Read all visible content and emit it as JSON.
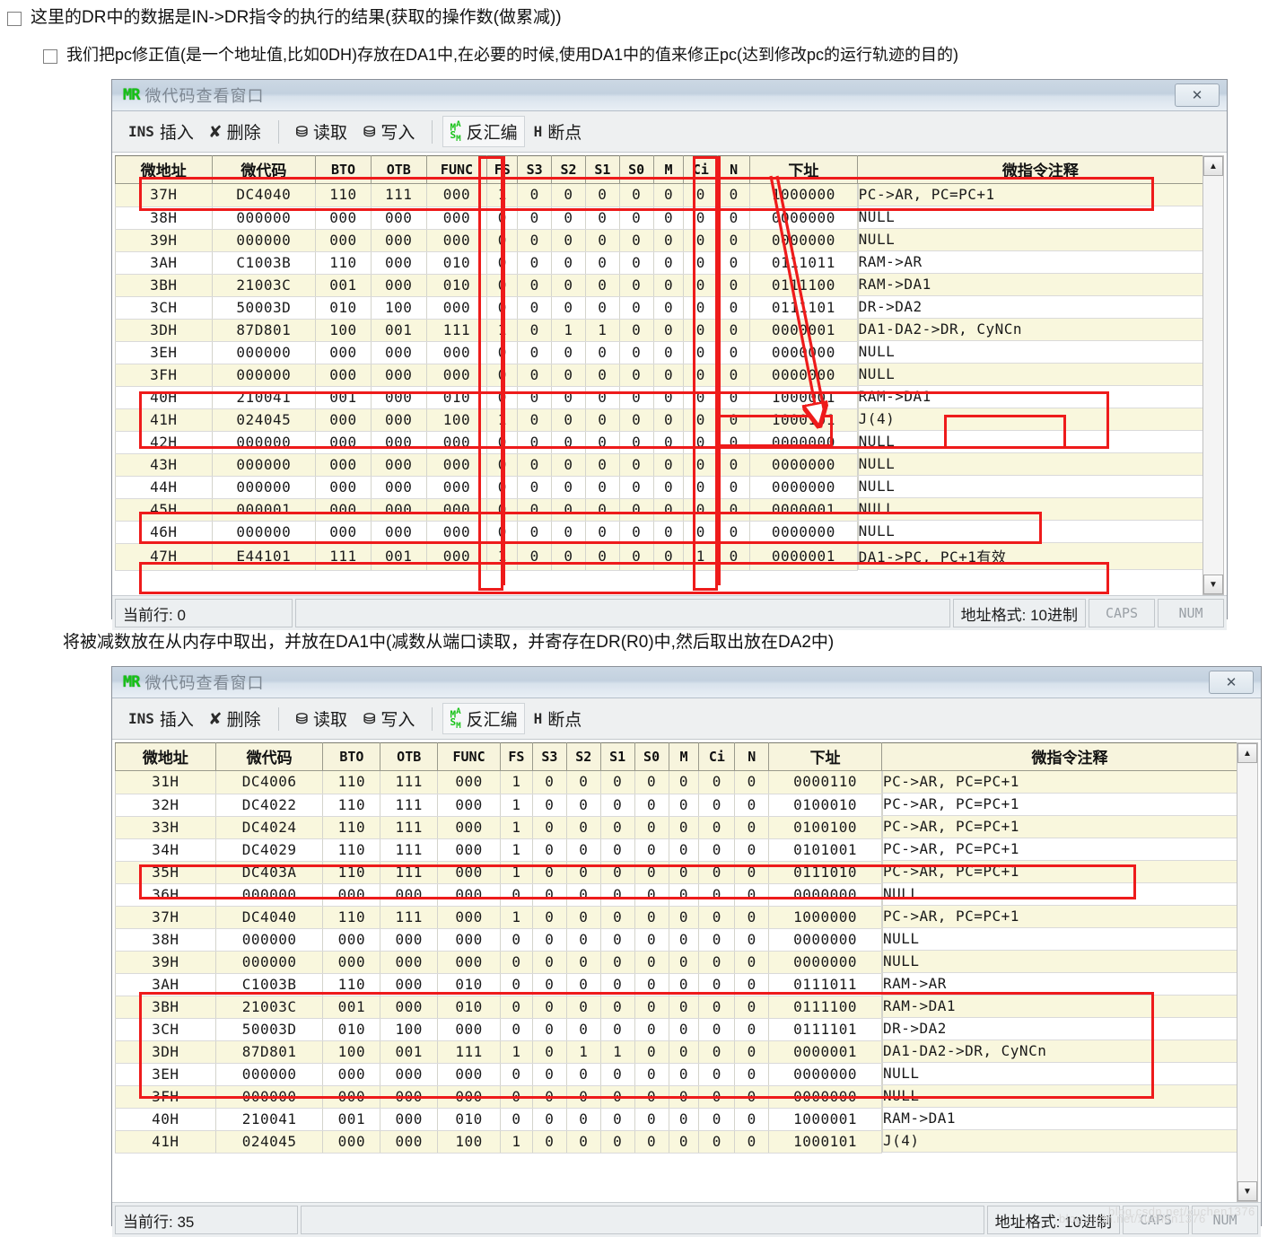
{
  "notes": {
    "line1": "这里的DR中的数据是IN->DR指令的执行的结果(获取的操作数(做累减))",
    "line2": "我们把pc修正值(是一个地址值,比如0DH)存放在DA1中,在必要的时候,使用DA1中的值来修正pc(达到修改pc的运行轨迹的目的)",
    "middle": "将被减数放在从内存中取出，并放在DA1中(减数从端口读取，并寄存在DR(R0)中,然后取出放在DA2中)"
  },
  "window": {
    "title": "微代码查看窗口",
    "logo": "MR",
    "close_label": "✕",
    "toolbar": [
      {
        "icon": "INS",
        "icon_name": "insert-icon",
        "label": "插入"
      },
      {
        "icon": "✘",
        "icon_name": "delete-x-icon",
        "label": "删除"
      },
      {
        "icon": "⛁",
        "icon_name": "read-icon",
        "label": "读取"
      },
      {
        "icon": "⛁",
        "icon_name": "write-icon",
        "label": "写入"
      },
      {
        "icon": "MASM",
        "icon_name": "masm-icon",
        "label": "反汇编"
      },
      {
        "icon": "H",
        "icon_name": "breakpoint-icon",
        "label": "断点"
      }
    ],
    "columns": [
      "微地址",
      "微代码",
      "BTO",
      "OTB",
      "FUNC",
      "FS",
      "S3",
      "S2",
      "S1",
      "S0",
      "M",
      "Ci",
      "N",
      "下址",
      "微指令注释"
    ],
    "scroll_up": "▲",
    "scroll_down": "▼"
  },
  "window1": {
    "status": {
      "current_row": "当前行: 0",
      "addr_format": "地址格式: 10进制",
      "caps": "CAPS",
      "num": "NUM"
    },
    "rows": [
      {
        "addr": "37H",
        "code": "DC4040",
        "bto": "110",
        "otb": "111",
        "func": "000",
        "fs": "1",
        "s3": "0",
        "s2": "0",
        "s1": "0",
        "s0": "0",
        "m": "0",
        "ci": "0",
        "n": "0",
        "next": "1000000",
        "comment": "PC->AR, PC=PC+1"
      },
      {
        "addr": "38H",
        "code": "000000",
        "bto": "000",
        "otb": "000",
        "func": "000",
        "fs": "0",
        "s3": "0",
        "s2": "0",
        "s1": "0",
        "s0": "0",
        "m": "0",
        "ci": "0",
        "n": "0",
        "next": "0000000",
        "comment": "NULL"
      },
      {
        "addr": "39H",
        "code": "000000",
        "bto": "000",
        "otb": "000",
        "func": "000",
        "fs": "0",
        "s3": "0",
        "s2": "0",
        "s1": "0",
        "s0": "0",
        "m": "0",
        "ci": "0",
        "n": "0",
        "next": "0000000",
        "comment": "NULL"
      },
      {
        "addr": "3AH",
        "code": "C1003B",
        "bto": "110",
        "otb": "000",
        "func": "010",
        "fs": "0",
        "s3": "0",
        "s2": "0",
        "s1": "0",
        "s0": "0",
        "m": "0",
        "ci": "0",
        "n": "0",
        "next": "0111011",
        "comment": "RAM->AR"
      },
      {
        "addr": "3BH",
        "code": "21003C",
        "bto": "001",
        "otb": "000",
        "func": "010",
        "fs": "0",
        "s3": "0",
        "s2": "0",
        "s1": "0",
        "s0": "0",
        "m": "0",
        "ci": "0",
        "n": "0",
        "next": "0111100",
        "comment": "RAM->DA1"
      },
      {
        "addr": "3CH",
        "code": "50003D",
        "bto": "010",
        "otb": "100",
        "func": "000",
        "fs": "0",
        "s3": "0",
        "s2": "0",
        "s1": "0",
        "s0": "0",
        "m": "0",
        "ci": "0",
        "n": "0",
        "next": "0111101",
        "comment": "DR->DA2"
      },
      {
        "addr": "3DH",
        "code": "87D801",
        "bto": "100",
        "otb": "001",
        "func": "111",
        "fs": "1",
        "s3": "0",
        "s2": "1",
        "s1": "1",
        "s0": "0",
        "m": "0",
        "ci": "0",
        "n": "0",
        "next": "0000001",
        "comment": "DA1-DA2->DR, CyNCn"
      },
      {
        "addr": "3EH",
        "code": "000000",
        "bto": "000",
        "otb": "000",
        "func": "000",
        "fs": "0",
        "s3": "0",
        "s2": "0",
        "s1": "0",
        "s0": "0",
        "m": "0",
        "ci": "0",
        "n": "0",
        "next": "0000000",
        "comment": "NULL"
      },
      {
        "addr": "3FH",
        "code": "000000",
        "bto": "000",
        "otb": "000",
        "func": "000",
        "fs": "0",
        "s3": "0",
        "s2": "0",
        "s1": "0",
        "s0": "0",
        "m": "0",
        "ci": "0",
        "n": "0",
        "next": "0000000",
        "comment": "NULL"
      },
      {
        "addr": "40H",
        "code": "210041",
        "bto": "001",
        "otb": "000",
        "func": "010",
        "fs": "0",
        "s3": "0",
        "s2": "0",
        "s1": "0",
        "s0": "0",
        "m": "0",
        "ci": "0",
        "n": "0",
        "next": "1000001",
        "comment": "RAM->DA1"
      },
      {
        "addr": "41H",
        "code": "024045",
        "bto": "000",
        "otb": "000",
        "func": "100",
        "fs": "1",
        "s3": "0",
        "s2": "0",
        "s1": "0",
        "s0": "0",
        "m": "0",
        "ci": "0",
        "n": "0",
        "next": "1000101",
        "comment": "J(4)"
      },
      {
        "addr": "42H",
        "code": "000000",
        "bto": "000",
        "otb": "000",
        "func": "000",
        "fs": "0",
        "s3": "0",
        "s2": "0",
        "s1": "0",
        "s0": "0",
        "m": "0",
        "ci": "0",
        "n": "0",
        "next": "0000000",
        "comment": "NULL"
      },
      {
        "addr": "43H",
        "code": "000000",
        "bto": "000",
        "otb": "000",
        "func": "000",
        "fs": "0",
        "s3": "0",
        "s2": "0",
        "s1": "0",
        "s0": "0",
        "m": "0",
        "ci": "0",
        "n": "0",
        "next": "0000000",
        "comment": "NULL"
      },
      {
        "addr": "44H",
        "code": "000000",
        "bto": "000",
        "otb": "000",
        "func": "000",
        "fs": "0",
        "s3": "0",
        "s2": "0",
        "s1": "0",
        "s0": "0",
        "m": "0",
        "ci": "0",
        "n": "0",
        "next": "0000000",
        "comment": "NULL"
      },
      {
        "addr": "45H",
        "code": "000001",
        "bto": "000",
        "otb": "000",
        "func": "000",
        "fs": "0",
        "s3": "0",
        "s2": "0",
        "s1": "0",
        "s0": "0",
        "m": "0",
        "ci": "0",
        "n": "0",
        "next": "0000001",
        "comment": "NULL"
      },
      {
        "addr": "46H",
        "code": "000000",
        "bto": "000",
        "otb": "000",
        "func": "000",
        "fs": "0",
        "s3": "0",
        "s2": "0",
        "s1": "0",
        "s0": "0",
        "m": "0",
        "ci": "0",
        "n": "0",
        "next": "0000000",
        "comment": "NULL"
      },
      {
        "addr": "47H",
        "code": "E44101",
        "bto": "111",
        "otb": "001",
        "func": "000",
        "fs": "1",
        "s3": "0",
        "s2": "0",
        "s1": "0",
        "s0": "0",
        "m": "0",
        "ci": "1",
        "n": "0",
        "next": "0000001",
        "comment": "DA1->PC, PC+1有效"
      }
    ]
  },
  "window2": {
    "status": {
      "current_row": "当前行: 35",
      "addr_format": "地址格式: 10进制",
      "caps": "CAPS",
      "num": "NUM"
    },
    "rows": [
      {
        "addr": "31H",
        "code": "DC4006",
        "bto": "110",
        "otb": "111",
        "func": "000",
        "fs": "1",
        "s3": "0",
        "s2": "0",
        "s1": "0",
        "s0": "0",
        "m": "0",
        "ci": "0",
        "n": "0",
        "next": "0000110",
        "comment": "PC->AR, PC=PC+1"
      },
      {
        "addr": "32H",
        "code": "DC4022",
        "bto": "110",
        "otb": "111",
        "func": "000",
        "fs": "1",
        "s3": "0",
        "s2": "0",
        "s1": "0",
        "s0": "0",
        "m": "0",
        "ci": "0",
        "n": "0",
        "next": "0100010",
        "comment": "PC->AR, PC=PC+1"
      },
      {
        "addr": "33H",
        "code": "DC4024",
        "bto": "110",
        "otb": "111",
        "func": "000",
        "fs": "1",
        "s3": "0",
        "s2": "0",
        "s1": "0",
        "s0": "0",
        "m": "0",
        "ci": "0",
        "n": "0",
        "next": "0100100",
        "comment": "PC->AR, PC=PC+1"
      },
      {
        "addr": "34H",
        "code": "DC4029",
        "bto": "110",
        "otb": "111",
        "func": "000",
        "fs": "1",
        "s3": "0",
        "s2": "0",
        "s1": "0",
        "s0": "0",
        "m": "0",
        "ci": "0",
        "n": "0",
        "next": "0101001",
        "comment": "PC->AR, PC=PC+1"
      },
      {
        "addr": "35H",
        "code": "DC403A",
        "bto": "110",
        "otb": "111",
        "func": "000",
        "fs": "1",
        "s3": "0",
        "s2": "0",
        "s1": "0",
        "s0": "0",
        "m": "0",
        "ci": "0",
        "n": "0",
        "next": "0111010",
        "comment": "PC->AR, PC=PC+1"
      },
      {
        "addr": "36H",
        "code": "000000",
        "bto": "000",
        "otb": "000",
        "func": "000",
        "fs": "0",
        "s3": "0",
        "s2": "0",
        "s1": "0",
        "s0": "0",
        "m": "0",
        "ci": "0",
        "n": "0",
        "next": "0000000",
        "comment": "NULL"
      },
      {
        "addr": "37H",
        "code": "DC4040",
        "bto": "110",
        "otb": "111",
        "func": "000",
        "fs": "1",
        "s3": "0",
        "s2": "0",
        "s1": "0",
        "s0": "0",
        "m": "0",
        "ci": "0",
        "n": "0",
        "next": "1000000",
        "comment": "PC->AR, PC=PC+1"
      },
      {
        "addr": "38H",
        "code": "000000",
        "bto": "000",
        "otb": "000",
        "func": "000",
        "fs": "0",
        "s3": "0",
        "s2": "0",
        "s1": "0",
        "s0": "0",
        "m": "0",
        "ci": "0",
        "n": "0",
        "next": "0000000",
        "comment": "NULL"
      },
      {
        "addr": "39H",
        "code": "000000",
        "bto": "000",
        "otb": "000",
        "func": "000",
        "fs": "0",
        "s3": "0",
        "s2": "0",
        "s1": "0",
        "s0": "0",
        "m": "0",
        "ci": "0",
        "n": "0",
        "next": "0000000",
        "comment": "NULL"
      },
      {
        "addr": "3AH",
        "code": "C1003B",
        "bto": "110",
        "otb": "000",
        "func": "010",
        "fs": "0",
        "s3": "0",
        "s2": "0",
        "s1": "0",
        "s0": "0",
        "m": "0",
        "ci": "0",
        "n": "0",
        "next": "0111011",
        "comment": "RAM->AR"
      },
      {
        "addr": "3BH",
        "code": "21003C",
        "bto": "001",
        "otb": "000",
        "func": "010",
        "fs": "0",
        "s3": "0",
        "s2": "0",
        "s1": "0",
        "s0": "0",
        "m": "0",
        "ci": "0",
        "n": "0",
        "next": "0111100",
        "comment": "RAM->DA1"
      },
      {
        "addr": "3CH",
        "code": "50003D",
        "bto": "010",
        "otb": "100",
        "func": "000",
        "fs": "0",
        "s3": "0",
        "s2": "0",
        "s1": "0",
        "s0": "0",
        "m": "0",
        "ci": "0",
        "n": "0",
        "next": "0111101",
        "comment": "DR->DA2"
      },
      {
        "addr": "3DH",
        "code": "87D801",
        "bto": "100",
        "otb": "001",
        "func": "111",
        "fs": "1",
        "s3": "0",
        "s2": "1",
        "s1": "1",
        "s0": "0",
        "m": "0",
        "ci": "0",
        "n": "0",
        "next": "0000001",
        "comment": "DA1-DA2->DR, CyNCn"
      },
      {
        "addr": "3EH",
        "code": "000000",
        "bto": "000",
        "otb": "000",
        "func": "000",
        "fs": "0",
        "s3": "0",
        "s2": "0",
        "s1": "0",
        "s0": "0",
        "m": "0",
        "ci": "0",
        "n": "0",
        "next": "0000000",
        "comment": "NULL"
      },
      {
        "addr": "3FH",
        "code": "000000",
        "bto": "000",
        "otb": "000",
        "func": "000",
        "fs": "0",
        "s3": "0",
        "s2": "0",
        "s1": "0",
        "s0": "0",
        "m": "0",
        "ci": "0",
        "n": "0",
        "next": "0000000",
        "comment": "NULL"
      },
      {
        "addr": "40H",
        "code": "210041",
        "bto": "001",
        "otb": "000",
        "func": "010",
        "fs": "0",
        "s3": "0",
        "s2": "0",
        "s1": "0",
        "s0": "0",
        "m": "0",
        "ci": "0",
        "n": "0",
        "next": "1000001",
        "comment": "RAM->DA1"
      },
      {
        "addr": "41H",
        "code": "024045",
        "bto": "000",
        "otb": "000",
        "func": "100",
        "fs": "1",
        "s3": "0",
        "s2": "0",
        "s1": "0",
        "s0": "0",
        "m": "0",
        "ci": "0",
        "n": "0",
        "next": "1000101",
        "comment": "J(4)"
      }
    ]
  },
  "annotation_color": "#ee1b1b",
  "watermark": "blog.csdn.net/xuchen1376"
}
